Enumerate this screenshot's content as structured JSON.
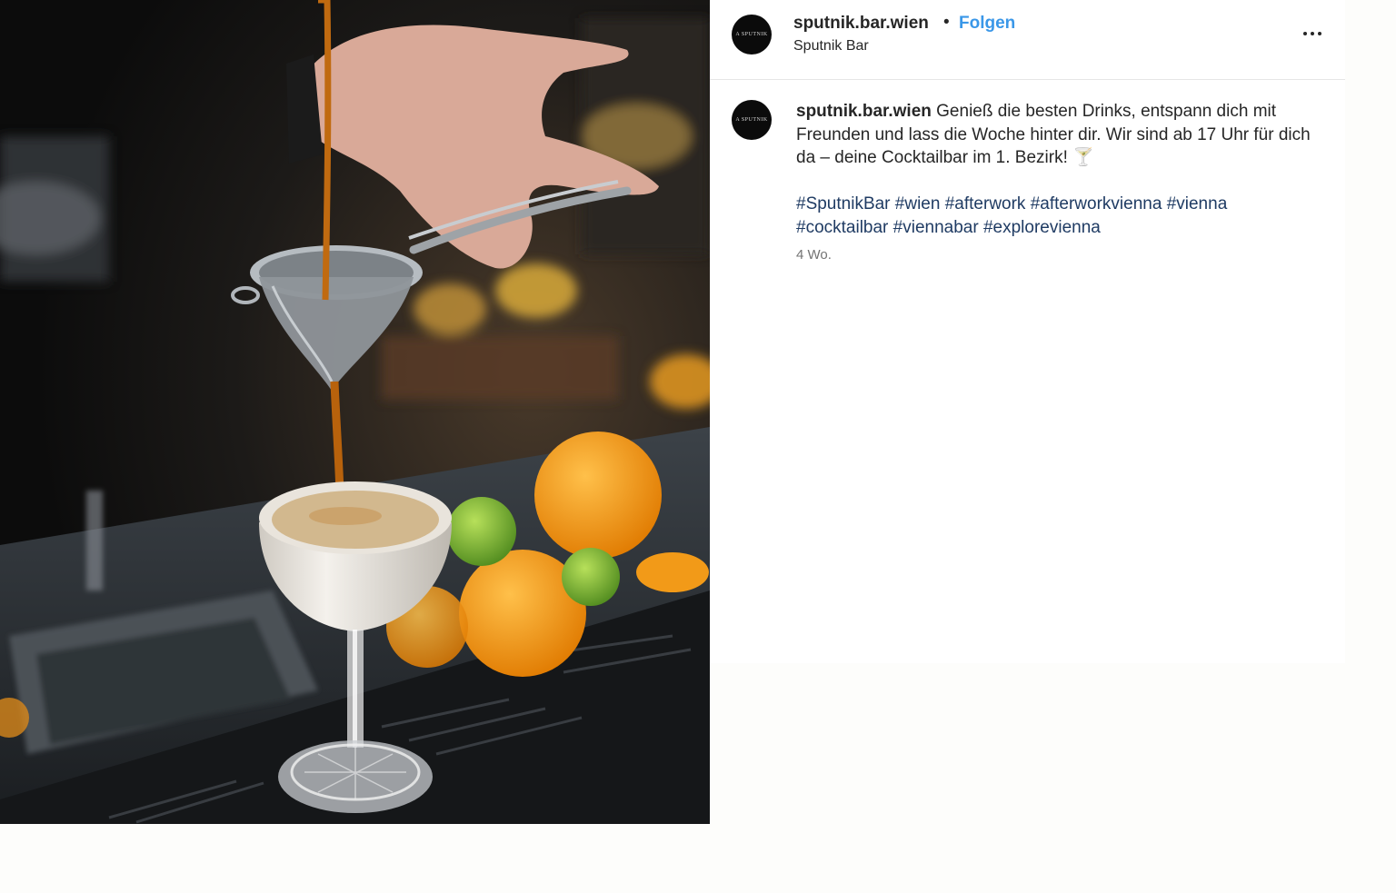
{
  "post": {
    "image_alt": "",
    "header": {
      "username": "sputnik.bar.wien",
      "separator": "•",
      "follow_label": "Folgen",
      "location": "Sputnik Bar",
      "avatar_text": "A SPUTNIK",
      "more_icon": "more-options-icon"
    },
    "caption": {
      "username": "sputnik.bar.wien",
      "text": "Genieß die besten Drinks, entspann dich mit Freunden und lass die Woche hinter dir. Wir sind ab 17 Uhr für dich da – deine Cocktailbar im 1. Bezirk! 🍸",
      "hashtags": [
        "#SputnikBar",
        "#wien",
        "#afterwork",
        "#afterworkvienna",
        "#vienna",
        "#cocktailbar",
        "#viennabar",
        "#explorevienna"
      ],
      "time": "4 Wo."
    },
    "colors": {
      "follow": "#3a97e8",
      "hashtag": "#1f3b63",
      "text": "#262626",
      "muted": "#737373"
    }
  }
}
